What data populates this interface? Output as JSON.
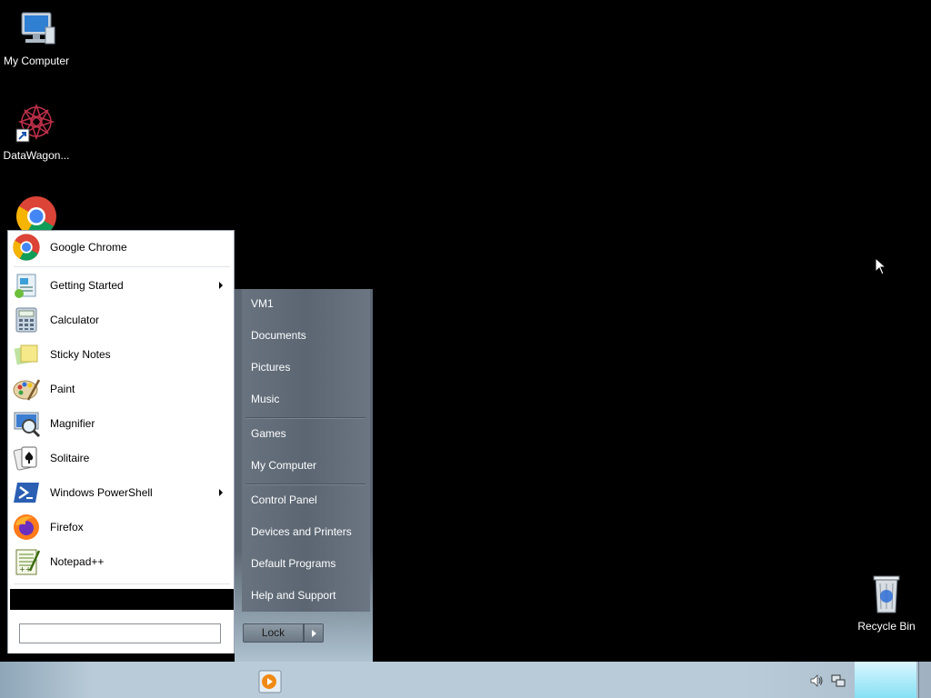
{
  "desktop": {
    "icons": [
      {
        "label": "My Computer"
      },
      {
        "label": "DataWagon..."
      },
      {
        "label": "Recycle Bin"
      }
    ]
  },
  "start_menu": {
    "programs": [
      {
        "label": "Google Chrome",
        "icon": "chrome-icon",
        "submenu": false
      },
      {
        "label": "Getting Started",
        "icon": "getting-started-icon",
        "submenu": true
      },
      {
        "label": "Calculator",
        "icon": "calculator-icon",
        "submenu": false
      },
      {
        "label": "Sticky Notes",
        "icon": "sticky-notes-icon",
        "submenu": false
      },
      {
        "label": "Paint",
        "icon": "paint-icon",
        "submenu": false
      },
      {
        "label": "Magnifier",
        "icon": "magnifier-icon",
        "submenu": false
      },
      {
        "label": "Solitaire",
        "icon": "solitaire-icon",
        "submenu": false
      },
      {
        "label": "Windows PowerShell",
        "icon": "powershell-icon",
        "submenu": true
      },
      {
        "label": "Firefox",
        "icon": "firefox-icon",
        "submenu": false
      },
      {
        "label": "Notepad++",
        "icon": "notepadpp-icon",
        "submenu": false
      }
    ],
    "search": {
      "value": "",
      "placeholder": ""
    },
    "right_items": [
      {
        "label": "VM1"
      },
      {
        "label": "Documents"
      },
      {
        "label": "Pictures"
      },
      {
        "label": "Music"
      },
      {
        "label": "Games"
      },
      {
        "label": "My Computer"
      },
      {
        "label": "Control Panel"
      },
      {
        "label": "Devices and Printers"
      },
      {
        "label": "Default Programs"
      },
      {
        "label": "Help and Support"
      }
    ],
    "lock_label": "Lock"
  },
  "colors": {
    "desktop_bg": "#000000",
    "right_pane": "#5b6672",
    "taskbar": "#b9cbd8"
  }
}
